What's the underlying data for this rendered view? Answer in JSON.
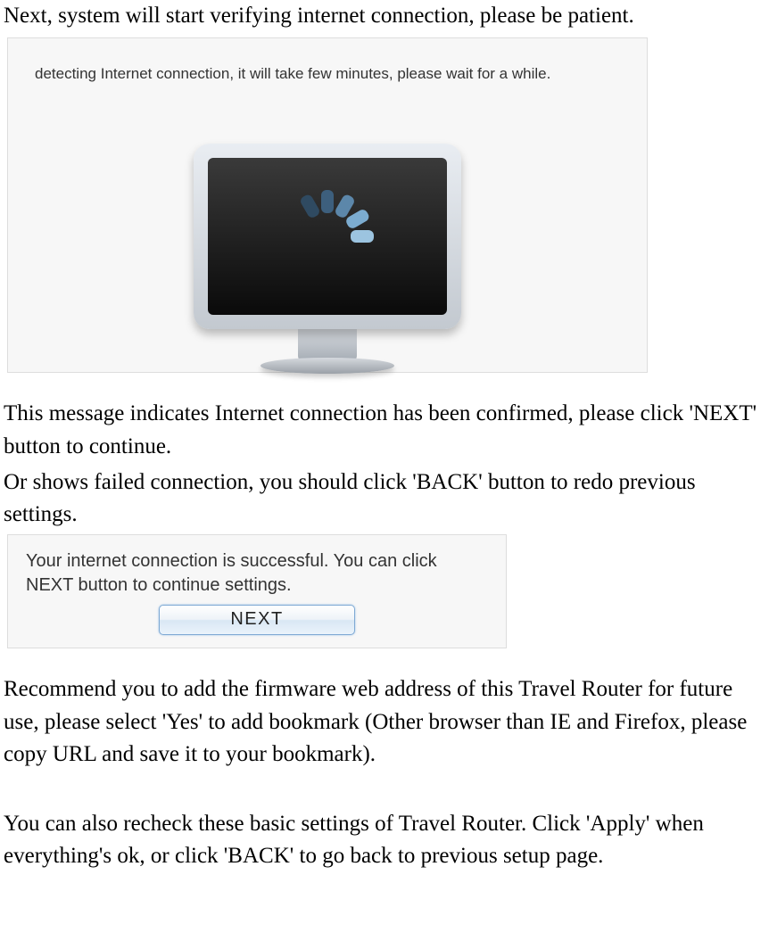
{
  "text": {
    "p1": "Next, system will start verifying internet connection, please be patient.",
    "p2": "This message indicates Internet connection has been confirmed, please click 'NEXT' button to continue.",
    "p3": "Or shows failed connection, you should click 'BACK' button to redo previous settings.",
    "p4": "Recommend you to add the firmware web address of this Travel Router for future use, please select 'Yes' to add bookmark (Other browser than IE and Firefox, please copy URL and save it to your bookmark).",
    "p5": "You can also recheck these basic settings of Travel Router. Click 'Apply' when everything's ok, or click 'BACK' to go back to previous setup page."
  },
  "screenshot1": {
    "status_text": "detecting Internet connection, it will take few minutes, please wait for a while.",
    "icon_name": "monitor-loading-icon",
    "spinner_color_dark": "#3a5a78",
    "spinner_color_light": "#7fb3d8"
  },
  "screenshot2": {
    "success_text": "Your internet connection is successful. You can click NEXT button to continue settings.",
    "button_label": "NEXT"
  }
}
